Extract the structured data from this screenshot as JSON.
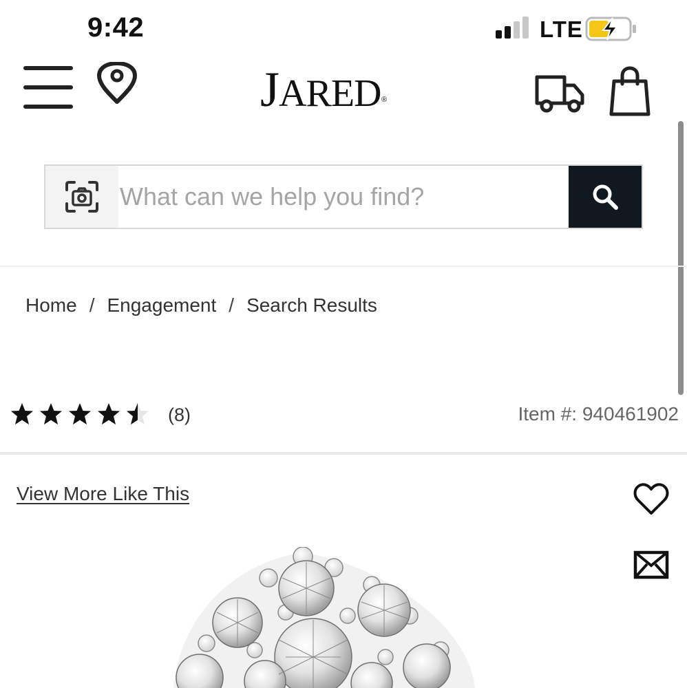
{
  "status_bar": {
    "time": "9:42",
    "network": "LTE"
  },
  "header": {
    "logo_initial": "J",
    "logo_rest": "ARED",
    "logo_mark": "®"
  },
  "search": {
    "placeholder": "What can we help you find?",
    "value": ""
  },
  "breadcrumb": [
    {
      "label": "Home"
    },
    {
      "label": "Engagement"
    },
    {
      "label": "Search Results"
    }
  ],
  "breadcrumb_separator": "/",
  "product": {
    "rating": 4.5,
    "rating_max": 5,
    "review_count": "(8)",
    "item_number": "Item #: 940461902",
    "view_more": "View More Like This"
  },
  "colors": {
    "search_button": "#101820",
    "battery_charge": "#f5c518",
    "text_primary": "#333333",
    "text_secondary": "#666666"
  },
  "icons": [
    "menu-icon",
    "location-pin-icon",
    "truck-icon",
    "shopping-bag-icon",
    "camera-icon",
    "search-icon",
    "star-icon",
    "heart-icon",
    "envelope-icon"
  ]
}
